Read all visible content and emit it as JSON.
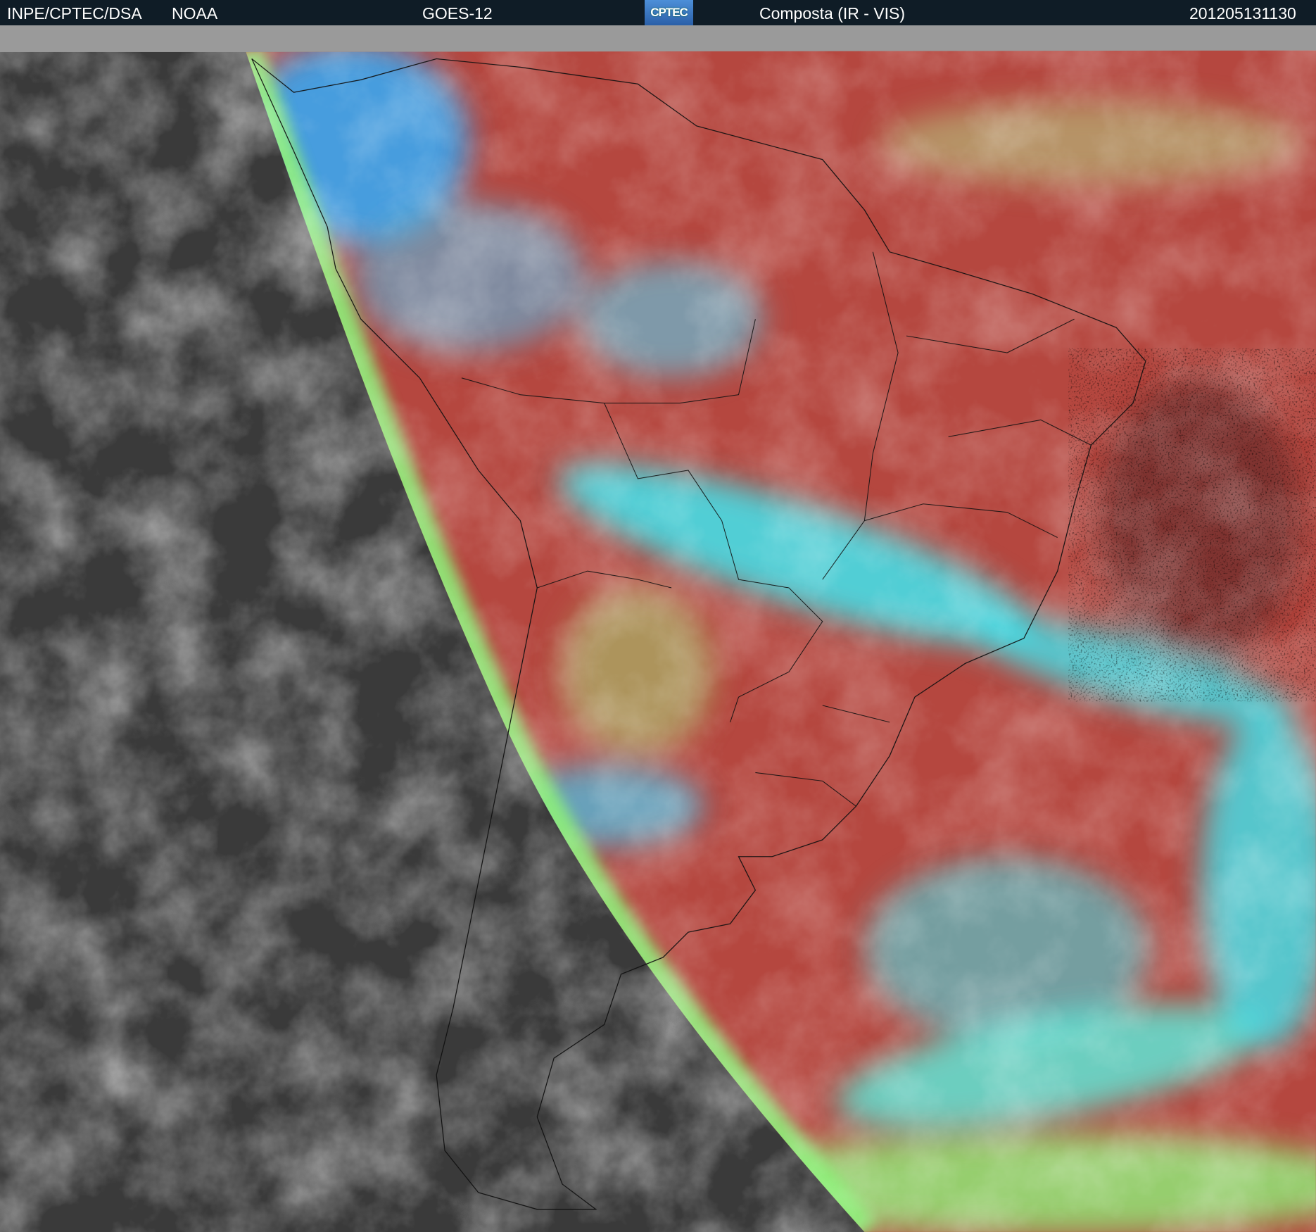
{
  "header": {
    "agency": "INPE/CPTEC/DSA",
    "source": "NOAA",
    "satellite": "GOES-12",
    "logo_text": "CPTEC",
    "product": "Composta (IR - VIS)",
    "timestamp": "201205131130"
  },
  "colors": {
    "header_bg": "#0f1c26",
    "land_ir": "#b5473f",
    "cloud_cyan": "#3ee6f0",
    "cloud_green": "#8ef07a",
    "night_gray": "#3c3c3c"
  }
}
